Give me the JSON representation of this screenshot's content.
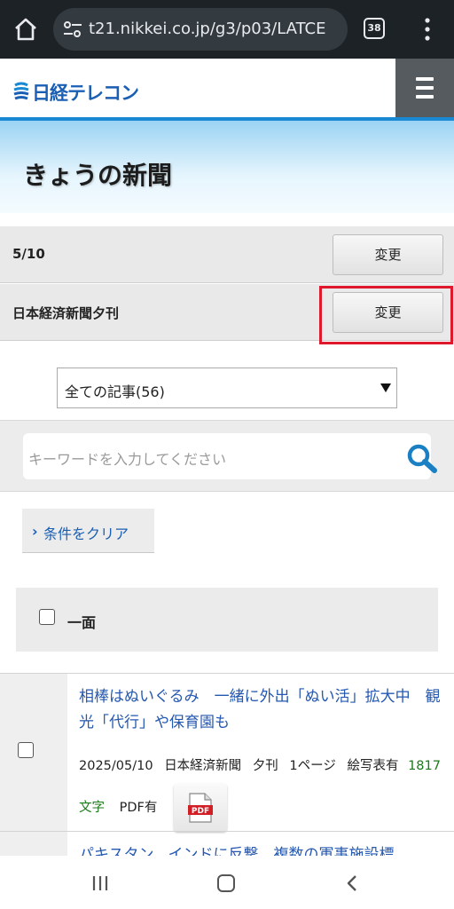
{
  "browser": {
    "url": "t21.nikkei.co.jp/g3/p03/LATCE",
    "tab_count": "38"
  },
  "site": {
    "logo_text": "日経テレコン",
    "brand_color": "#1a5fb4"
  },
  "page": {
    "title": "きょうの新聞"
  },
  "settings": {
    "date_label": "5/10",
    "date_change_label": "変更",
    "paper_label": "日本経済新聞夕刊",
    "paper_change_label": "変更",
    "highlight_color": "#e0182d"
  },
  "filter": {
    "selected": "全ての記事(56)"
  },
  "search": {
    "placeholder": "キーワードを入力してください"
  },
  "clear": {
    "label": "条件をクリア"
  },
  "section": {
    "title": "一面"
  },
  "articles": [
    {
      "title": "相棒はぬいぐるみ　一緒に外出「ぬい活」拡大中　観光「代行」や保育園も",
      "date": "2025/05/10",
      "paper": "日本経済新聞",
      "edition": "夕刊",
      "page": "1ページ",
      "photo": "絵写表有",
      "chars": "1817文字",
      "pdf": "PDF有",
      "pdf_button": "PDF"
    },
    {
      "title": "パキスタン、インドに反撃　複数の軍事施設標"
    }
  ]
}
